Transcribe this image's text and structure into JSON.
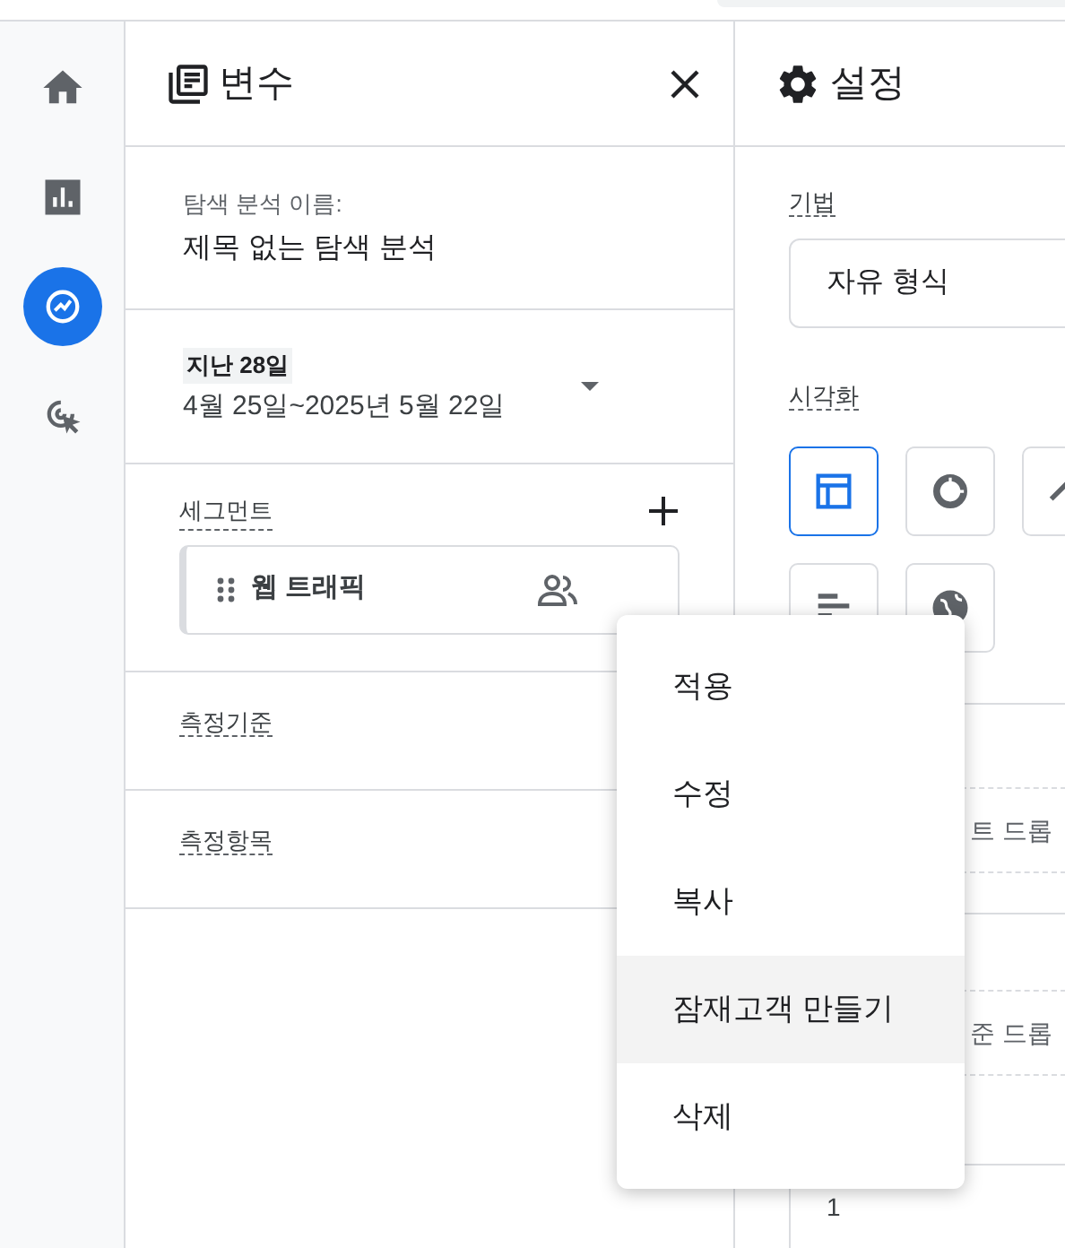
{
  "nav_rail": {
    "items": [
      {
        "kind": "home",
        "selected": false
      },
      {
        "kind": "reports",
        "selected": false
      },
      {
        "kind": "explore",
        "selected": true
      },
      {
        "kind": "advertising",
        "selected": false
      }
    ]
  },
  "variables_panel": {
    "title": "변수",
    "exploration_name": {
      "label": "탐색 분석 이름:",
      "value": "제목 없는 탐색 분석"
    },
    "date_range": {
      "preset": "지난 28일",
      "range": "4월 25일~2025년 5월 22일"
    },
    "segments": {
      "label": "세그먼트",
      "items": [
        {
          "name": "웹 트래픽"
        }
      ]
    },
    "dimensions": {
      "label": "측정기준"
    },
    "metrics": {
      "label": "측정항목"
    }
  },
  "settings_panel": {
    "title": "설정",
    "technique": {
      "label": "기법",
      "value": "자유 형식"
    },
    "visualization": {
      "label": "시각화",
      "options": [
        {
          "kind": "table",
          "selected": true
        },
        {
          "kind": "donut",
          "selected": false
        },
        {
          "kind": "line",
          "selected": false
        },
        {
          "kind": "bar",
          "selected": false
        },
        {
          "kind": "geo",
          "selected": false
        }
      ]
    },
    "drop_zones": [
      {
        "text": "트 드롭"
      },
      {
        "text": "준 드롭"
      }
    ],
    "row_count": "1"
  },
  "context_menu": {
    "items": [
      {
        "label": "적용",
        "highlighted": false
      },
      {
        "label": "수정",
        "highlighted": false
      },
      {
        "label": "복사",
        "highlighted": false
      },
      {
        "label": "잠재고객 만들기",
        "highlighted": true
      },
      {
        "label": "삭제",
        "highlighted": false
      }
    ]
  }
}
